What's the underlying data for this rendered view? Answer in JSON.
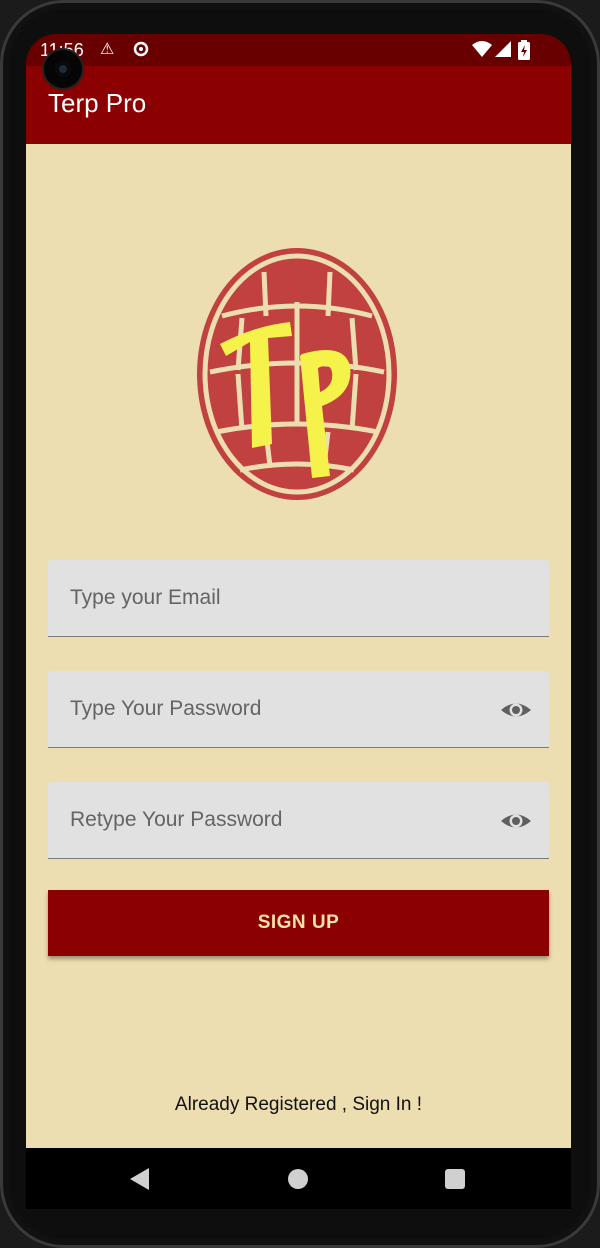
{
  "status_bar": {
    "time": "11:56",
    "icons": [
      "warning-icon",
      "sync-icon",
      "wifi-icon",
      "signal-icon",
      "battery-icon"
    ]
  },
  "app_bar": {
    "title": "Terp Pro"
  },
  "logo": {
    "text": "TP",
    "shell_color": "#c0413f",
    "text_color": "#f4f24b"
  },
  "form": {
    "email": {
      "placeholder": "Type your Email"
    },
    "password": {
      "placeholder": "Type Your Password"
    },
    "retype_password": {
      "placeholder": "Retype Your Password"
    },
    "signup_label": "SIGN UP",
    "signin_link": "Already Registered , Sign In !"
  },
  "colors": {
    "primary": "#8b0000",
    "status_bar": "#680000",
    "background": "#ecdeb0",
    "button_text": "#f6e3a8"
  },
  "nav_bar": {
    "icons": [
      "back-icon",
      "home-icon",
      "recents-icon"
    ]
  }
}
